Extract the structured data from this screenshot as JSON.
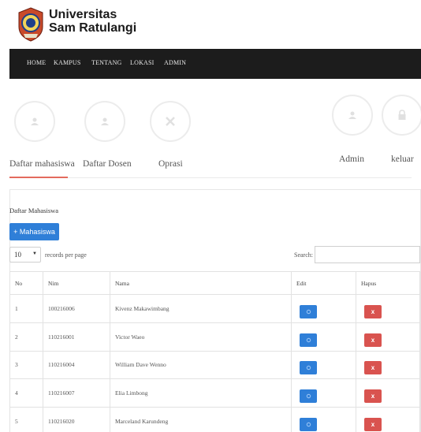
{
  "brand": {
    "line1": "Universitas",
    "line2": "Sam Ratulangi"
  },
  "nav": [
    "HOME",
    "KAMPUS",
    "TENTANG",
    "LOKASI",
    "ADMIN"
  ],
  "menu_tabs": [
    {
      "label": "Daftar mahasiswa",
      "icon": "user-icon",
      "active": true
    },
    {
      "label": "Daftar Dosen",
      "icon": "user-icon"
    },
    {
      "label": "Oprasi",
      "icon": "tools-icon"
    },
    {
      "label": "Admin",
      "icon": "user-icon"
    },
    {
      "label": "keluar",
      "icon": "lock-icon"
    }
  ],
  "panel": {
    "title": "Daftar Mahasiswa",
    "add_button": "+ Mahasiswa",
    "page_length": "10",
    "records_label": "records per page",
    "search_label": "Search:"
  },
  "table": {
    "headers": [
      "No",
      "Nim",
      "Nama",
      "Edit",
      "Hapus"
    ],
    "rows": [
      {
        "no": "1",
        "nim": "100216006",
        "nama": "Kivenz Makawimbang"
      },
      {
        "no": "2",
        "nim": "110216001",
        "nama": "Victor Waeo"
      },
      {
        "no": "3",
        "nim": "110216004",
        "nama": "William Dave Wenno"
      },
      {
        "no": "4",
        "nim": "110216007",
        "nama": "Elia Limbong"
      },
      {
        "no": "5",
        "nim": "110216020",
        "nama": "Marceland Karundeng"
      }
    ],
    "delete_glyph": "x"
  },
  "colors": {
    "navbar": "#1c1c1c",
    "accent": "#e36b5e",
    "primary": "#2f7fd8",
    "danger": "#d9534f"
  }
}
